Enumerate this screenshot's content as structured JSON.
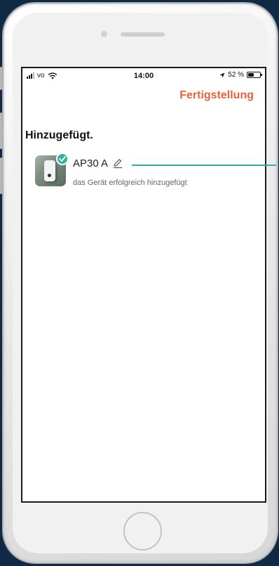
{
  "status_bar": {
    "carrier": "vo",
    "time": "14:00",
    "battery_percent_label": "52 %",
    "battery_level": 0.52
  },
  "header": {
    "done_label": "Fertigstellung"
  },
  "main": {
    "heading": "Hinzugefügt.",
    "device": {
      "name": "AP30 A",
      "status": "das Gerät erfolgreich hinzugefügt"
    }
  },
  "colors": {
    "accent": "#e8623a",
    "success": "#2cb69a",
    "pointer": "#2db3a3",
    "background": "#0f2a44"
  },
  "icons": [
    "signal-icon",
    "wifi-icon",
    "location-arrow-icon",
    "battery-icon",
    "check-icon",
    "pencil-icon"
  ]
}
